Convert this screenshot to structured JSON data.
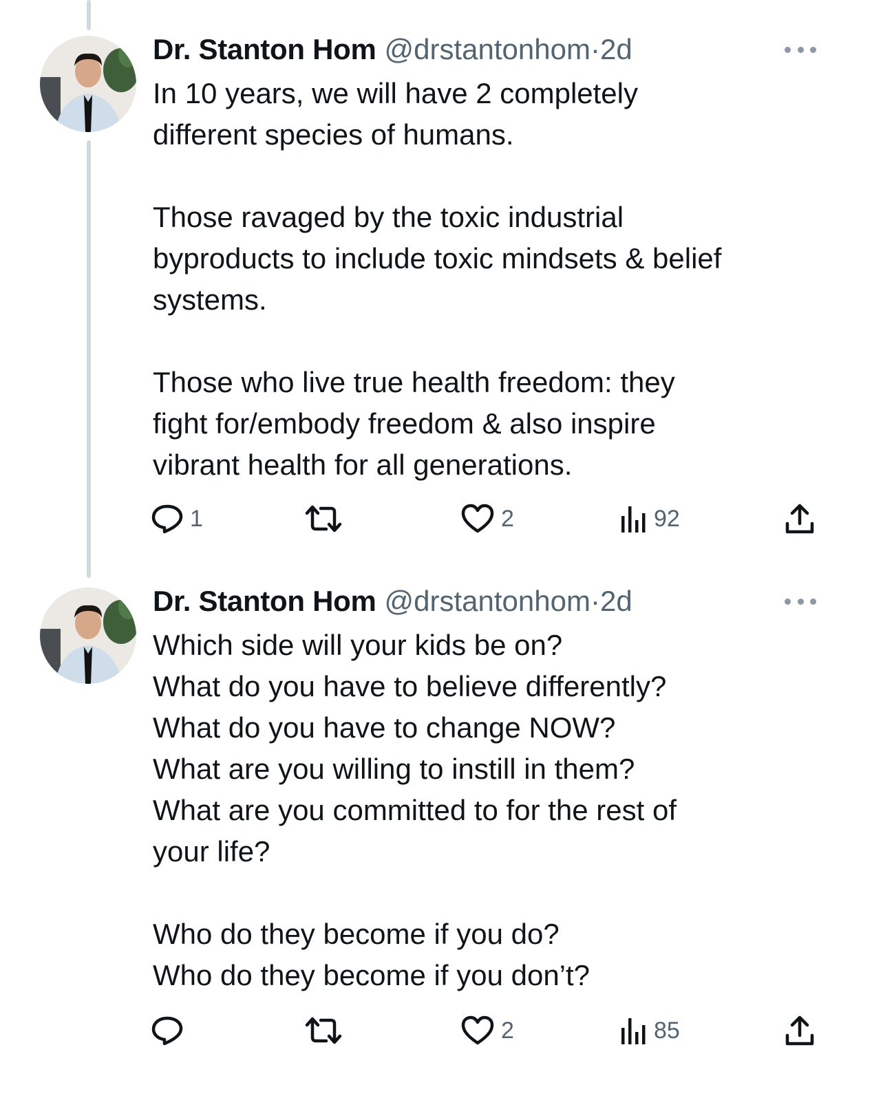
{
  "tweets": [
    {
      "author": {
        "name": "Dr. Stanton Hom",
        "handle": "@drstantonhom",
        "separator": "·",
        "time": "2d"
      },
      "paragraphs": [
        "In 10 years, we will have 2 completely\ndifferent species of humans.",
        "Those ravaged by the toxic industrial\nbyproducts to include toxic mindsets & belief\nsystems.",
        "Those who live true health freedom: they\nfight for/embody freedom & also inspire\nvibrant health for all generations."
      ],
      "actions": {
        "replies": "1",
        "retweets": "",
        "likes": "2",
        "views": "92"
      }
    },
    {
      "author": {
        "name": "Dr. Stanton Hom",
        "handle": "@drstantonhom",
        "separator": "·",
        "time": "2d"
      },
      "paragraphs": [
        "Which side will your kids be on?\nWhat do you have to believe differently?\nWhat do you have to change NOW?\nWhat are you willing to instill in them?\nWhat are you committed to for the rest of\nyour life?",
        "Who do they become if you do?\nWho do they become if you don’t?"
      ],
      "actions": {
        "replies": "",
        "retweets": "",
        "likes": "2",
        "views": "85"
      }
    }
  ],
  "icons": {
    "reply": "reply-icon",
    "retweet": "retweet-icon",
    "like": "heart-icon",
    "views": "views-icon",
    "share": "share-icon",
    "more": "more-icon"
  },
  "colors": {
    "text": "#0f1419",
    "secondary": "#536471",
    "thread_line": "#cfd9de"
  }
}
